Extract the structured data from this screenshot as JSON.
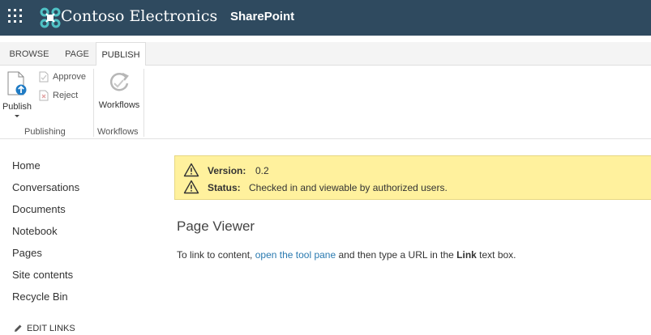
{
  "suite_bar": {
    "brand": "Contoso Electronics",
    "app": "SharePoint"
  },
  "ribbon": {
    "tabs": [
      {
        "label": "BROWSE",
        "active": false
      },
      {
        "label": "PAGE",
        "active": false
      },
      {
        "label": "PUBLISH",
        "active": true
      }
    ],
    "publishing": {
      "publish_label": "Publish",
      "approve_label": "Approve",
      "reject_label": "Reject",
      "group_label": "Publishing"
    },
    "workflows": {
      "button_label": "Workflows",
      "group_label": "Workflows"
    }
  },
  "nav": {
    "items": [
      "Home",
      "Conversations",
      "Documents",
      "Notebook",
      "Pages",
      "Site contents",
      "Recycle Bin"
    ],
    "edit_links": "EDIT LINKS"
  },
  "status": {
    "version_label": "Version:",
    "version_value": "0.2",
    "status_label": "Status:",
    "status_value": "Checked in and viewable by authorized users."
  },
  "content": {
    "title": "Page Viewer",
    "instruction_pre": "To link to content, ",
    "instruction_link": "open the tool pane",
    "instruction_mid": " and then type a URL in the ",
    "instruction_bold": "Link",
    "instruction_post": " text box."
  },
  "colors": {
    "suite_bar": "#2f4a5f",
    "status_bg": "#fff19d",
    "link": "#2a7ab0",
    "logo_teal": "#4fc3c6"
  },
  "icons": {
    "waffle": "app-launcher-icon",
    "logo": "contoso-logo-icon",
    "publish": "publish-icon",
    "approve": "approve-icon",
    "reject": "reject-icon",
    "workflows": "workflows-icon",
    "warning": "warning-icon",
    "edit": "pencil-icon"
  }
}
